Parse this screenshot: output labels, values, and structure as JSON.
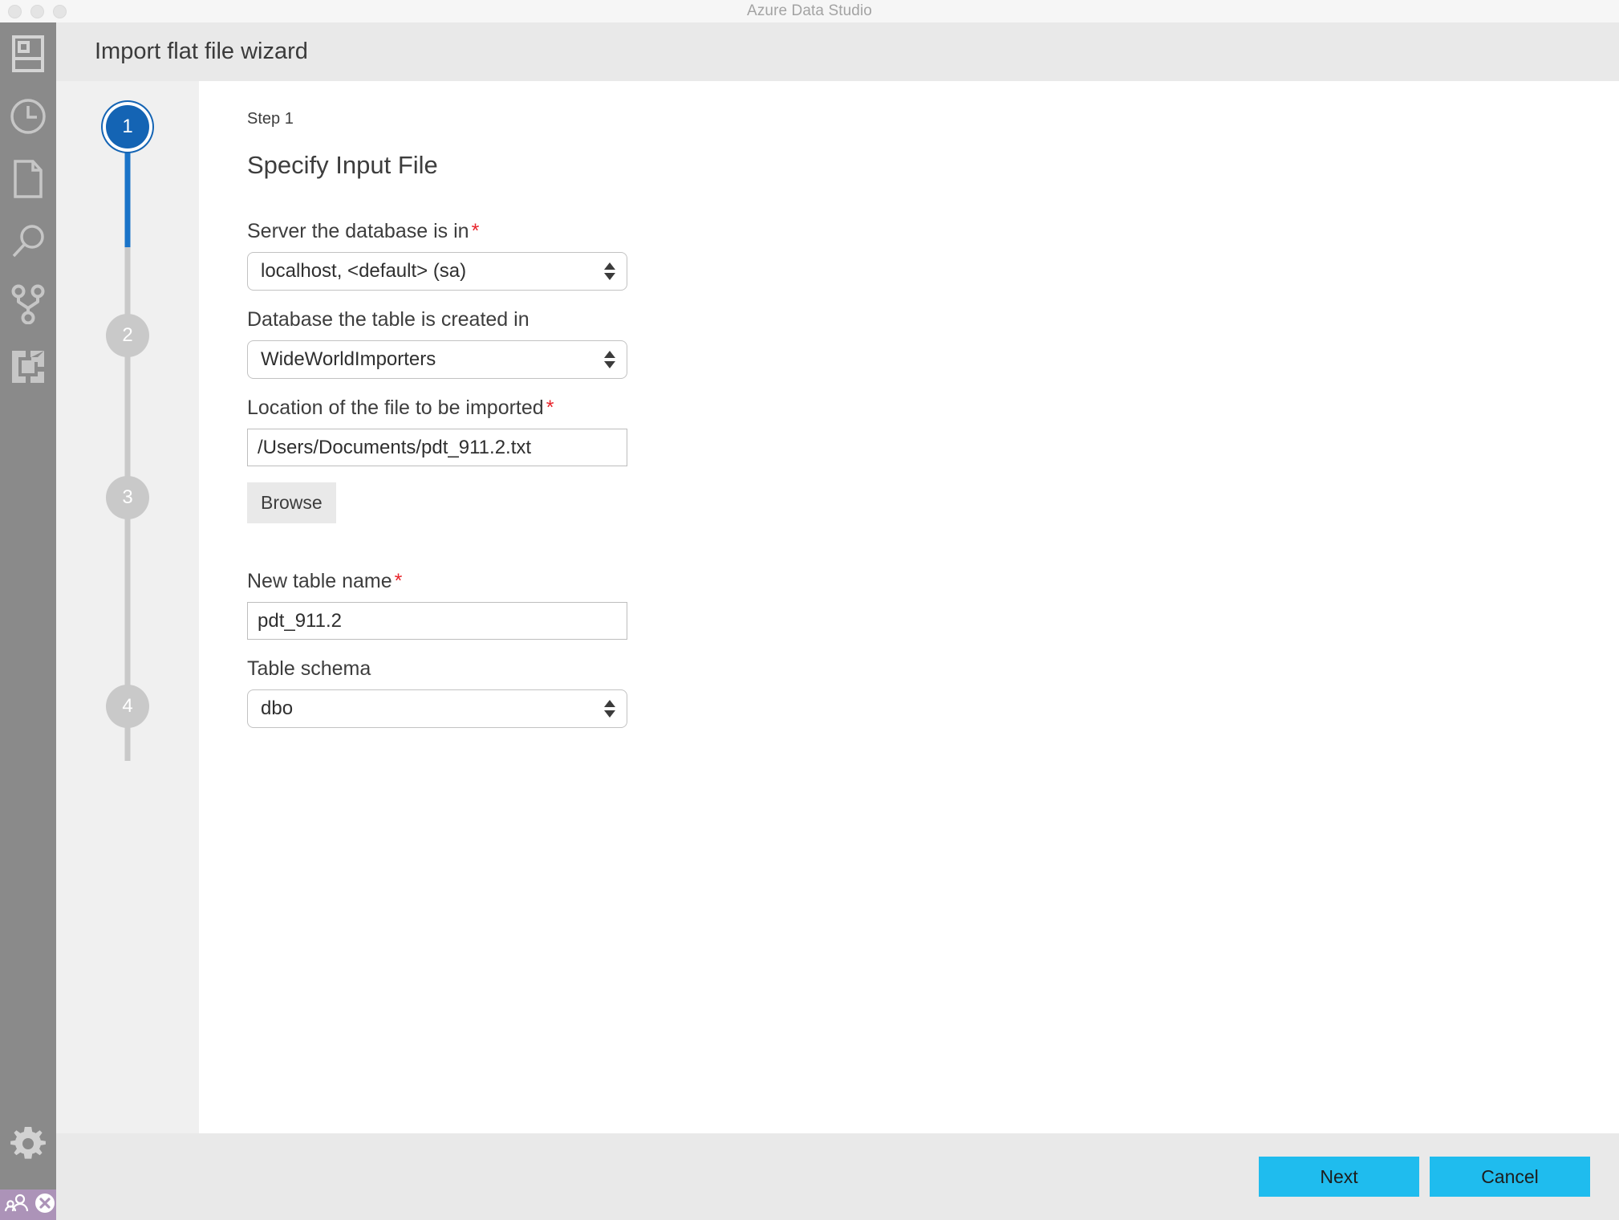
{
  "window": {
    "title": "Azure Data Studio",
    "traffic_lights": [
      "close",
      "minimize",
      "zoom"
    ]
  },
  "activity_bar": {
    "items": [
      {
        "icon": "servers-icon",
        "label": "Servers"
      },
      {
        "icon": "clock-history-icon",
        "label": "History"
      },
      {
        "icon": "file-document-icon",
        "label": "Open Editors"
      },
      {
        "icon": "search-icon",
        "label": "Search"
      },
      {
        "icon": "source-control-branch-icon",
        "label": "Source Control"
      },
      {
        "icon": "extensions-icon",
        "label": "Extensions"
      }
    ],
    "bottom_items": [
      {
        "icon": "gear-icon",
        "label": "Manage"
      }
    ]
  },
  "status_bar": {
    "background": "#ac93b8",
    "items": [
      {
        "icon": "accounts-person-icon",
        "label": "Accounts"
      },
      {
        "icon": "error-circle-x-icon",
        "label": "Errors"
      }
    ]
  },
  "header": {
    "title": "Import flat file wizard"
  },
  "steps": {
    "nodes": [
      {
        "number": "1",
        "state": "active"
      },
      {
        "number": "2",
        "state": "inactive"
      },
      {
        "number": "3",
        "state": "inactive"
      },
      {
        "number": "4",
        "state": "inactive"
      }
    ]
  },
  "page": {
    "eyebrow": "Step 1",
    "heading": "Specify Input File"
  },
  "form": {
    "server": {
      "label": "Server the database is in",
      "required": "*",
      "value": "localhost, <default> (sa)"
    },
    "database": {
      "label": "Database the table is created in",
      "required": "",
      "value": "WideWorldImporters"
    },
    "file_location": {
      "label": "Location of the file to be imported",
      "required": "*",
      "value": "/Users/Documents/pdt_911.2.txt",
      "placeholder": ""
    },
    "browse": {
      "label": "Browse"
    },
    "table_name": {
      "label": "New table name",
      "required": "*",
      "value": "pdt_911.2",
      "placeholder": ""
    },
    "table_schema": {
      "label": "Table schema",
      "required": "",
      "value": "dbo"
    }
  },
  "footer": {
    "next_label": "Next",
    "cancel_label": "Cancel",
    "accent_color": "#1fbcee"
  }
}
